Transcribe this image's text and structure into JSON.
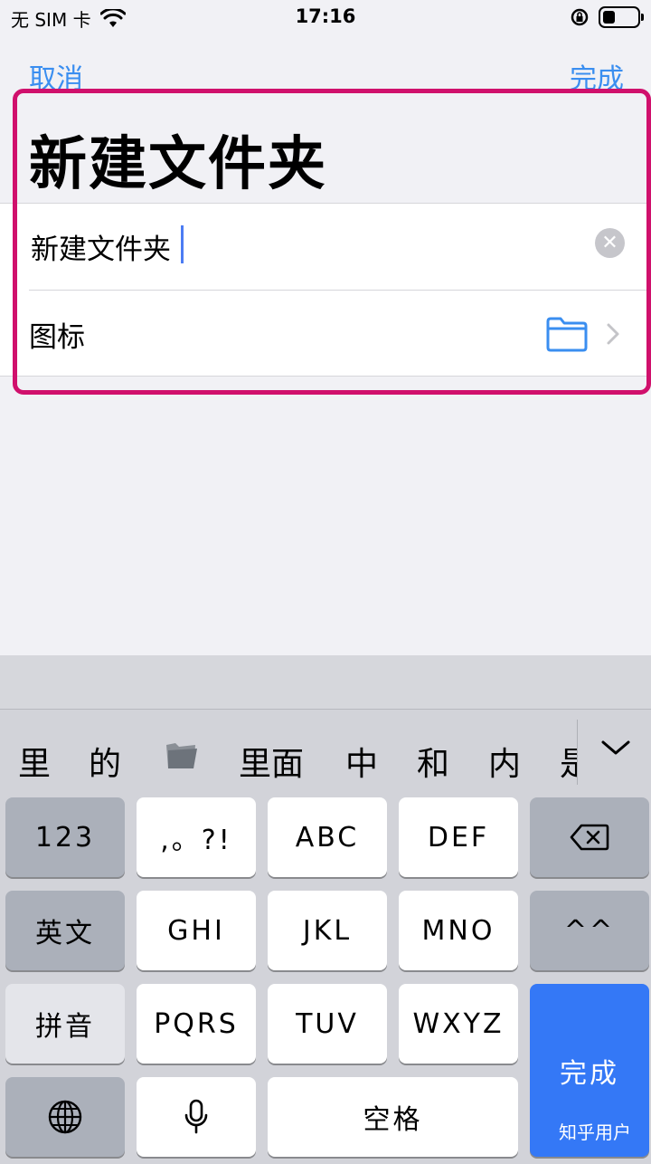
{
  "status_bar": {
    "carrier": "无 SIM 卡",
    "time": "17:16",
    "battery_level": 0.35
  },
  "nav": {
    "cancel": "取消",
    "done": "完成"
  },
  "page": {
    "title": "新建文件夹"
  },
  "form": {
    "name_value": "新建文件夹",
    "icon_label": "图标"
  },
  "keyboard": {
    "candidates": [
      "里",
      "的",
      "里面",
      "中",
      "和",
      "内",
      "是"
    ],
    "keys": {
      "k123": "123",
      "punct": ",。?!",
      "abc": "ABC",
      "def": "DEF",
      "english": "英文",
      "ghi": "GHI",
      "jkl": "JKL",
      "mno": "MNO",
      "emoji": "^^",
      "pinyin": "拼音",
      "pqrs": "PQRS",
      "tuv": "TUV",
      "wxyz": "WXYZ",
      "space": "空格",
      "done": "完成"
    },
    "watermark": "知乎用户"
  },
  "colors": {
    "accent": "#3a8ef0",
    "highlight": "#d0106c",
    "done_key": "#3478f6"
  }
}
